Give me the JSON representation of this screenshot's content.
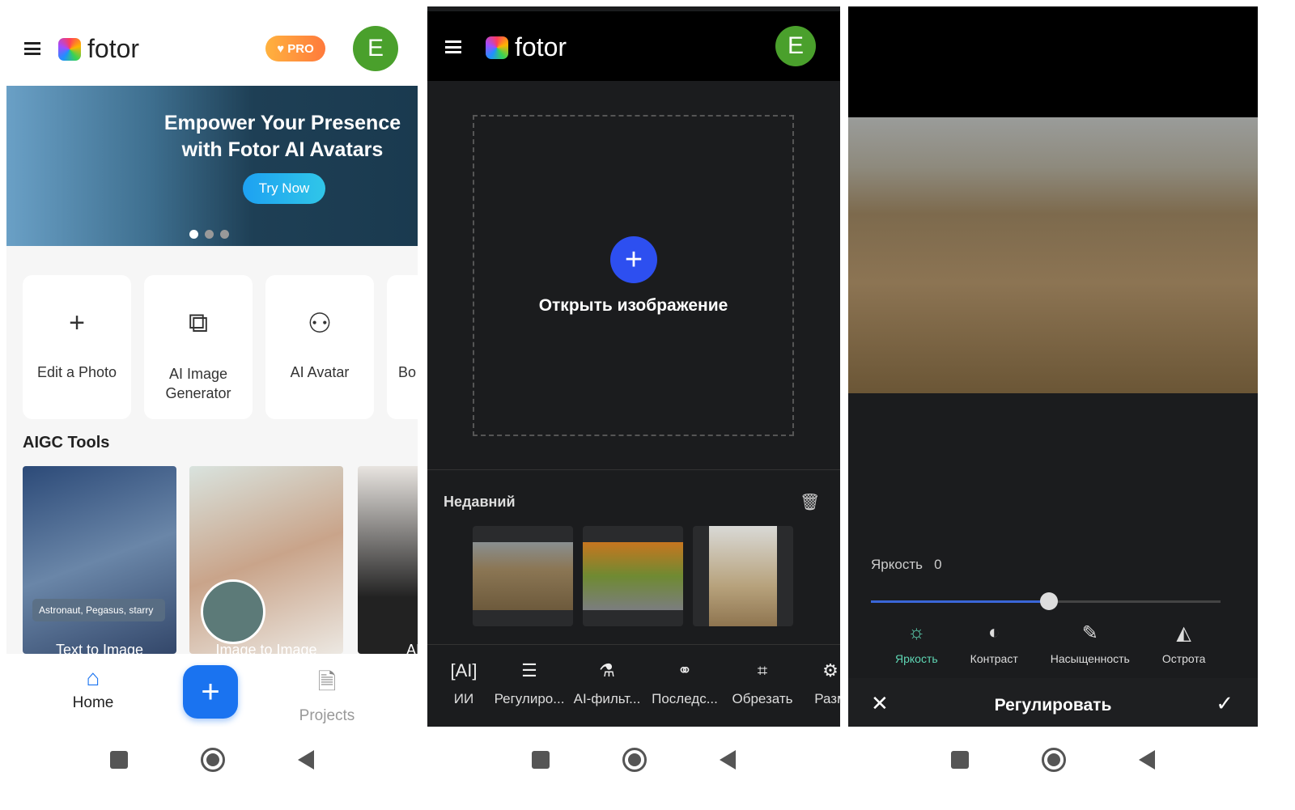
{
  "home": {
    "brand": "fotor",
    "pro_badge": "PRO",
    "avatar_letter": "E",
    "banner": {
      "title_line1": "Empower Your Presence",
      "title_line2": "with Fotor AI Avatars",
      "cta": "Try Now",
      "page_count": 3,
      "active_page": 1
    },
    "quick_actions": [
      {
        "label": "Edit a Photo",
        "icon": "plus-icon"
      },
      {
        "label": "AI Image Generator",
        "icon": "image-text-icon"
      },
      {
        "label": "AI Avatar",
        "icon": "user-sparkle-icon"
      },
      {
        "label": "Bo",
        "icon": "unknown"
      }
    ],
    "aigc_title": "AIGC Tools",
    "aigc_items": [
      {
        "label": "Text to Image",
        "prompt": "Astronaut, Pegasus, starry"
      },
      {
        "label": "Image to Image"
      },
      {
        "label": "AI"
      }
    ],
    "bottom_nav": {
      "home": "Home",
      "projects": "Projects",
      "accent": "#1a73f0"
    }
  },
  "editor": {
    "brand": "fotor",
    "avatar_letter": "E",
    "open_image": "Открыть изображение",
    "recent_title": "Недавний",
    "tools": [
      {
        "label": "ИИ",
        "icon": "ai-icon"
      },
      {
        "label": "Регулиро...",
        "icon": "sliders-icon"
      },
      {
        "label": "AI-фильт...",
        "icon": "flask-icon"
      },
      {
        "label": "Последс...",
        "icon": "effects-icon"
      },
      {
        "label": "Обрезать",
        "icon": "crop-icon"
      },
      {
        "label": "Разм",
        "icon": "resize-icon"
      }
    ]
  },
  "adjust": {
    "param_label": "Яркость",
    "param_value": "0",
    "slider_fraction": 0.51,
    "accent": "#5fd6b4",
    "options": [
      {
        "label": "Яркость",
        "icon": "sun-icon",
        "active": true
      },
      {
        "label": "Контраст",
        "icon": "contrast-icon"
      },
      {
        "label": "Насыщенность",
        "icon": "flashlight-icon"
      },
      {
        "label": "Острота",
        "icon": "sharpness-icon"
      }
    ],
    "title": "Регулировать"
  }
}
